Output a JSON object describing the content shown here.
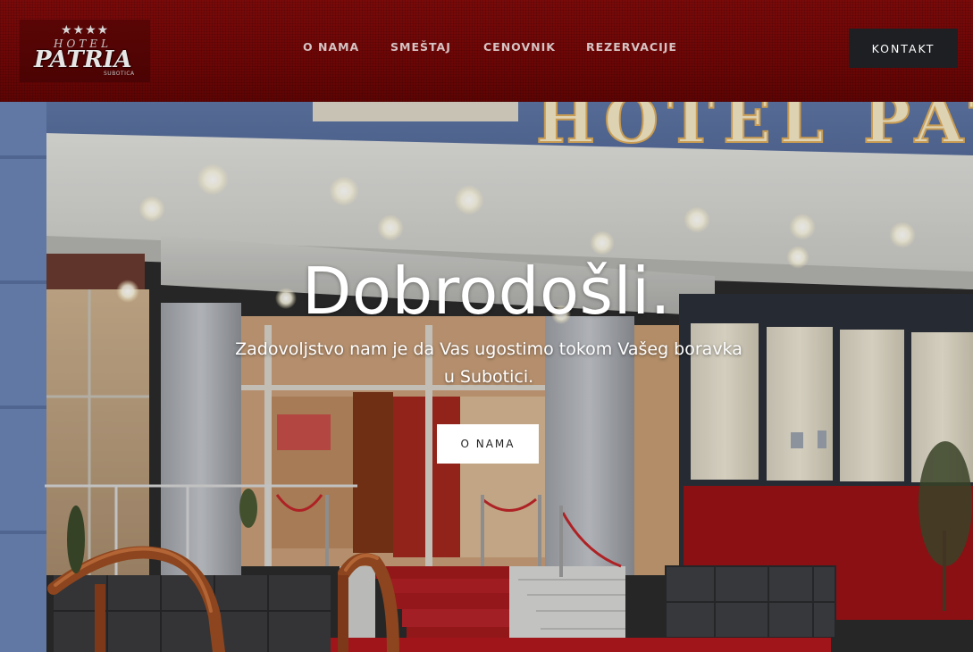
{
  "header": {
    "logo": {
      "stars": "★★★★",
      "hotel": "HOTEL",
      "name": "PATRIA",
      "city": "SUBOTICA"
    },
    "nav": [
      {
        "label": "O NAMA"
      },
      {
        "label": "SMEŠTAJ"
      },
      {
        "label": "CENOVNIK"
      },
      {
        "label": "REZERVACIJE"
      }
    ],
    "contact_label": "KONTAKT"
  },
  "hero": {
    "title": "Dobrodošli.",
    "subtitle": "Zadovoljstvo nam je da Vas ugostimo tokom Vašeg boravka u Subotici.",
    "button_label": "O NAMA",
    "sign_text": "HOTEL PATRIA"
  },
  "colors": {
    "header_bg": "#6d0606",
    "contact_bg": "#1d1f22",
    "hero_button_bg": "#ffffff",
    "carpet": "#a3151a"
  }
}
